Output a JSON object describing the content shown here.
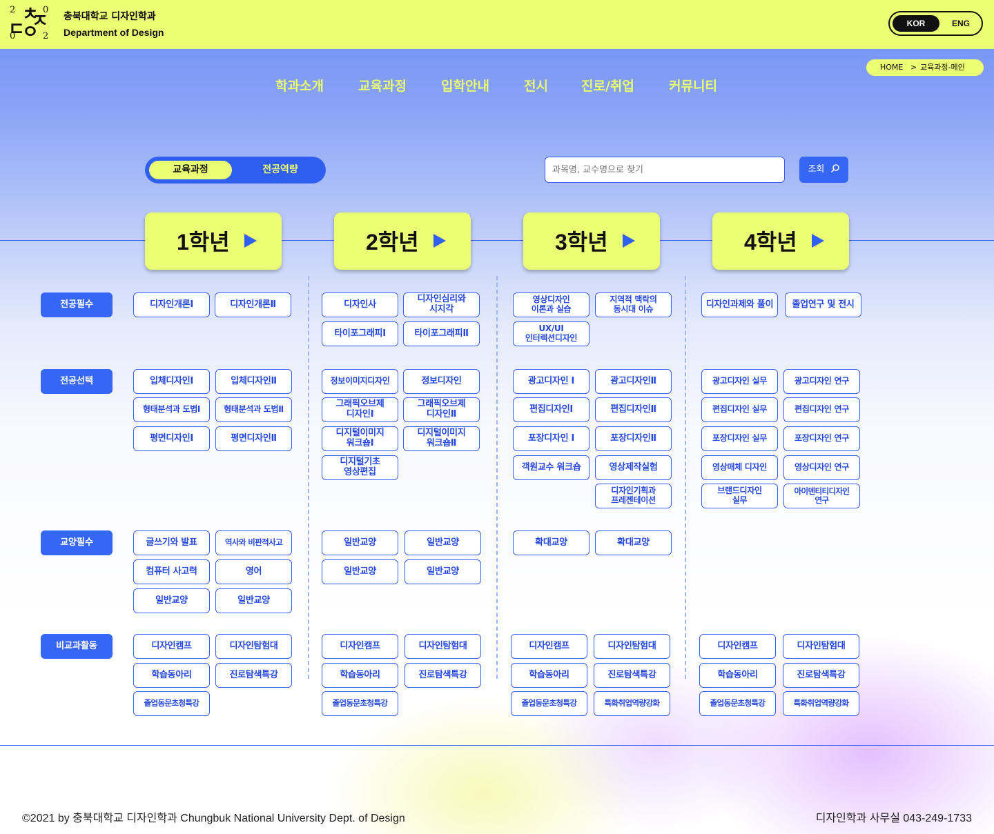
{
  "header": {
    "logo": {
      "chars": [
        "2",
        "ㄷ",
        "ㅊ",
        "0",
        "0",
        "ㅇ",
        "ㅈ",
        "2"
      ]
    },
    "brand_ko": "충북대학교 디자인학과",
    "brand_en": "Department of Design",
    "lang": {
      "active": "KOR",
      "inactive": "ENG"
    }
  },
  "breadcrumb": {
    "home": "HOME",
    "sep": ">",
    "current": "교육과정-메인"
  },
  "nav": [
    "학과소개",
    "교육과정",
    "입학안내",
    "전시",
    "진로/취업",
    "커뮤니티"
  ],
  "toggle": {
    "active": "교육과정",
    "inactive": "전공역량"
  },
  "search": {
    "placeholder": "과목명, 교수명으로 찾기",
    "button": "조회"
  },
  "years": [
    "1학년",
    "2학년",
    "3학년",
    "4학년"
  ],
  "categories": [
    "전공필수",
    "전공선택",
    "교양필수",
    "비교과활동"
  ],
  "courses": {
    "major_required": {
      "y1": [
        "디자인개론Ⅰ",
        "디자인개론Ⅱ"
      ],
      "y2": [
        "디자인사",
        "디자인심리와\n시지각",
        "타이포그래피Ⅰ",
        "타이포그래피Ⅱ"
      ],
      "y3": [
        "영상디자인\n이론과 실습",
        "지역적 맥락의\n동시대 이슈",
        "UX/UI\n인터렉션디자인"
      ],
      "y4": [
        "디자인과제와 풀이",
        "졸업연구 및 전시"
      ]
    },
    "major_elective": {
      "y1": [
        "입체디자인Ⅰ",
        "입체디자인Ⅱ",
        "형태분석과 도법Ⅰ",
        "형태분석과 도법Ⅱ",
        "평면디자인Ⅰ",
        "평면디자인Ⅱ"
      ],
      "y2": [
        "정보이미지디자인",
        "정보디자인",
        "그래픽오브제\n디자인Ⅰ",
        "그래픽오브제\n디자인Ⅱ",
        "디지털이미지\n워크숍Ⅰ",
        "디지털이미지\n워크숍Ⅱ",
        "디지털기초\n영상편집"
      ],
      "y3": [
        "광고디자인 Ⅰ",
        "광고디자인Ⅱ",
        "편집디자인Ⅰ",
        "편집디자인Ⅱ",
        "포장디자인 Ⅰ",
        "포장디자인Ⅱ",
        "객원교수 워크숍",
        "영상제작실험",
        "디자인기획과\n프레젠테이션"
      ],
      "y4": [
        "광고디자인 실무",
        "광고디자인 연구",
        "편집디자인 실무",
        "편집디자인 연구",
        "포장디자인 실무",
        "포장디자인 연구",
        "영상매체 디자인",
        "영상디자인 연구",
        "브랜드디자인\n실무",
        "아이덴티티디자인\n연구"
      ]
    },
    "liberal_required": {
      "y1": [
        "글쓰기와 발표",
        "역사와 비판적사고",
        "컴퓨터 사고력",
        "영어",
        "일반교양",
        "일반교양"
      ],
      "y2": [
        "일반교양",
        "일반교양",
        "일반교양",
        "일반교양"
      ],
      "y3": [
        "확대교양",
        "확대교양"
      ]
    },
    "extracurricular": {
      "y1": [
        "디자인캠프",
        "디자인탐험대",
        "학습동아리",
        "진로탐색특강",
        "졸업동문초청특강"
      ],
      "y2": [
        "디자인캠프",
        "디자인탐험대",
        "학습동아리",
        "진로탐색특강",
        "졸업동문초청특강"
      ],
      "y3": [
        "디자인캠프",
        "디자인탐험대",
        "학습동아리",
        "진로탐색특강",
        "졸업동문초청특강",
        "특화취업역량강화"
      ],
      "y4": [
        "디자인캠프",
        "디자인탐험대",
        "학습동아리",
        "진로탐색특강",
        "졸업동문초청특강",
        "특화취업역량강화"
      ]
    }
  },
  "footer": {
    "copyright": "©2021 by 충북대학교 디자인학과 Chungbuk National University Dept. of Design",
    "contact": "디자인학과 사무실 043-249-1733"
  }
}
